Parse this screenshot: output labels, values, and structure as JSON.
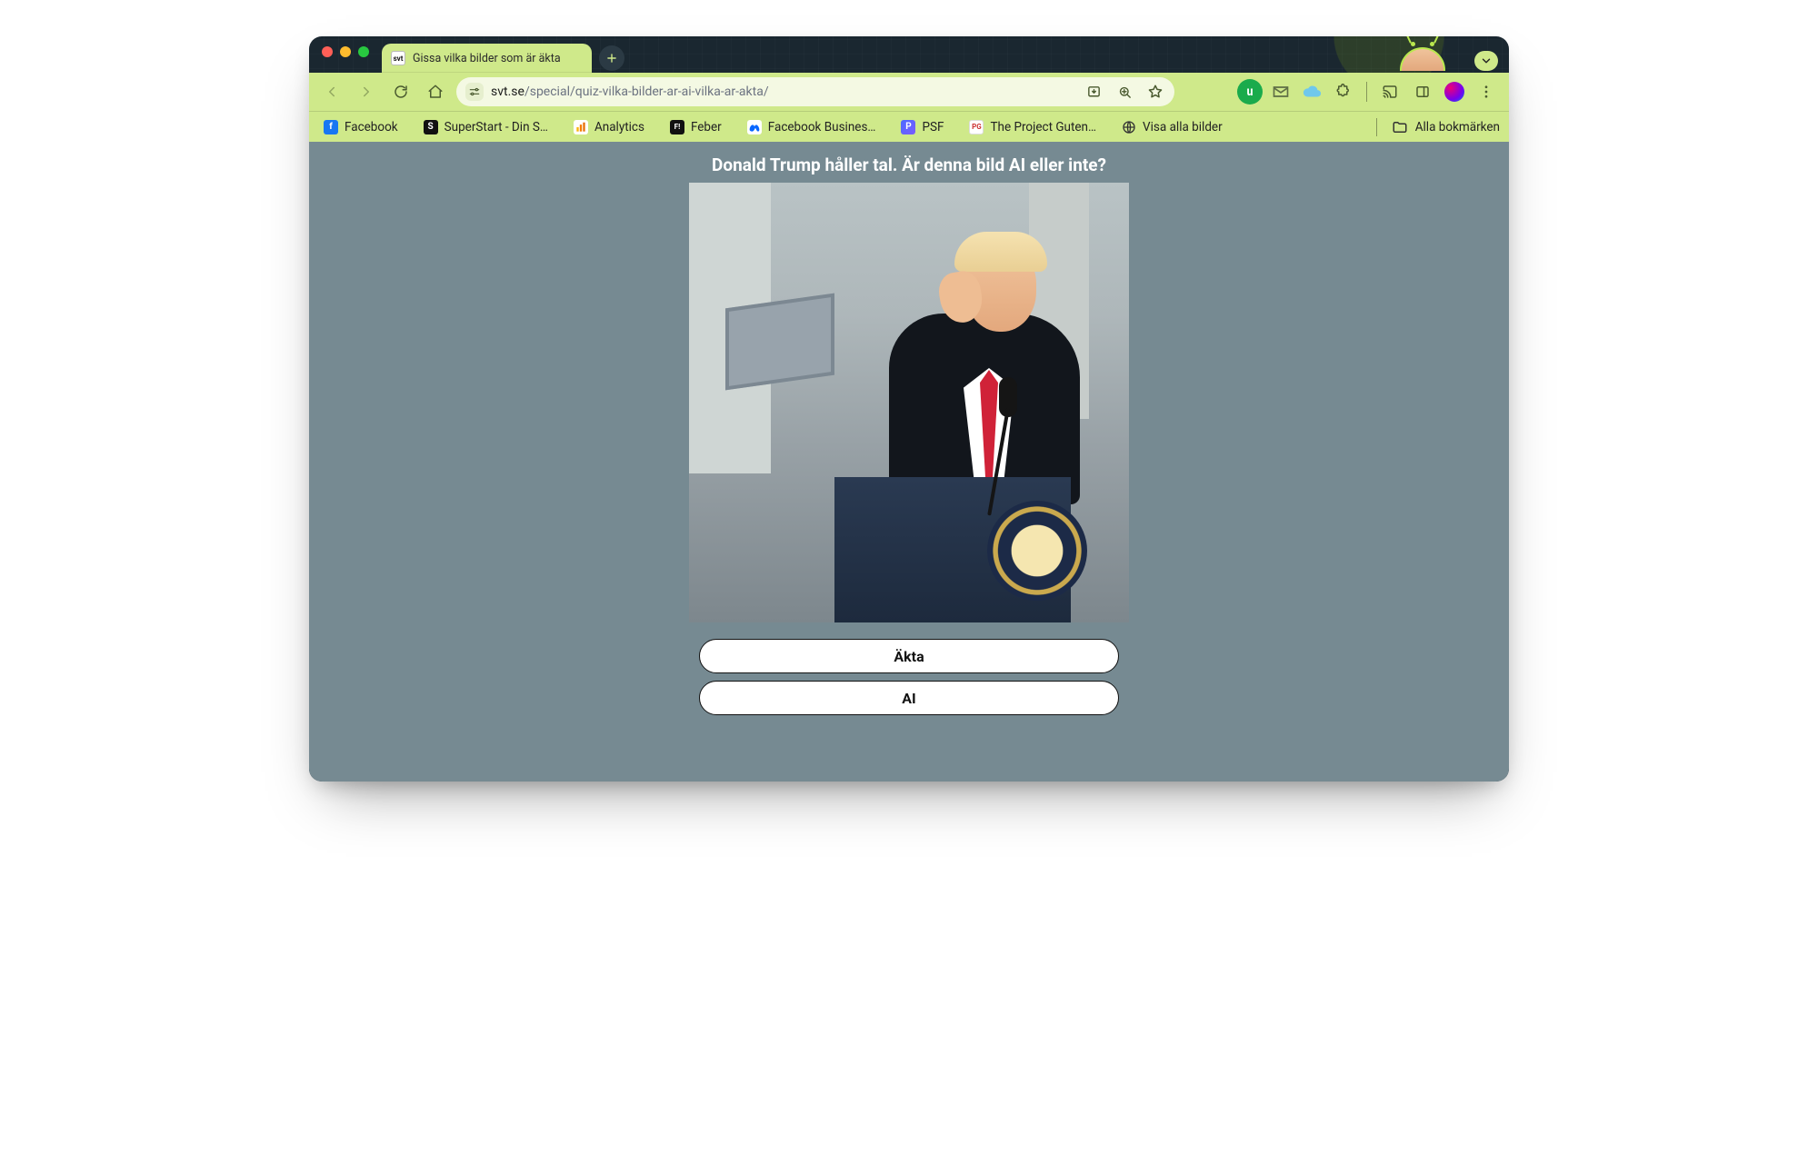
{
  "tab": {
    "title": "Gissa vilka bilder som är äkta",
    "favicon_text": "svt"
  },
  "toolbar": {
    "url_host": "svt.se",
    "url_path": "/special/quiz-vilka-bilder-ar-ai-vilka-ar-akta/"
  },
  "bookmarks": {
    "items": [
      {
        "label": "Facebook",
        "ico_bg": "#1877f2",
        "ico_txt": "f"
      },
      {
        "label": "SuperStart - Din S…",
        "ico_bg": "#111111",
        "ico_txt": "S"
      },
      {
        "label": "Analytics",
        "ico_bg": "#ffffff",
        "ico_txt": ""
      },
      {
        "label": "Feber",
        "ico_bg": "#111111",
        "ico_txt": "F!"
      },
      {
        "label": "Facebook Busines…",
        "ico_bg": "#ffffff",
        "ico_txt": ""
      },
      {
        "label": "PSF",
        "ico_bg": "#3f58ff",
        "ico_txt": "P"
      },
      {
        "label": "The Project Guten…",
        "ico_bg": "#ffffff",
        "ico_txt": "PG"
      },
      {
        "label": "Visa alla bilder",
        "ico_bg": "#333333",
        "ico_txt": ""
      }
    ],
    "all_label": "Alla bokmärken"
  },
  "quiz": {
    "question": "Donald Trump håller tal. Är denna bild AI eller inte?",
    "image_alt": "Donald Trump håller tal vid podium med presidentsigill",
    "option_real": "Äkta",
    "option_ai": "AI"
  },
  "icons": {
    "back": "back-icon",
    "forward": "forward-icon",
    "reload": "reload-icon",
    "home": "home-icon",
    "tune": "tune-icon",
    "install": "install-icon",
    "zoom": "zoom-icon",
    "star": "star-icon",
    "ext_plus": "u-plus-icon",
    "mail": "mail-icon",
    "cloud": "cloud-icon",
    "puzzle": "puzzle-icon",
    "cast": "cast-icon",
    "sidepanel": "sidepanel-icon",
    "menu": "menu-icon",
    "folder": "folder-icon",
    "globe": "globe-icon",
    "chevdown": "chevron-down-icon",
    "close": "close-icon",
    "plus": "plus-icon",
    "meta": "meta-icon",
    "analytics": "analytics-icon"
  }
}
